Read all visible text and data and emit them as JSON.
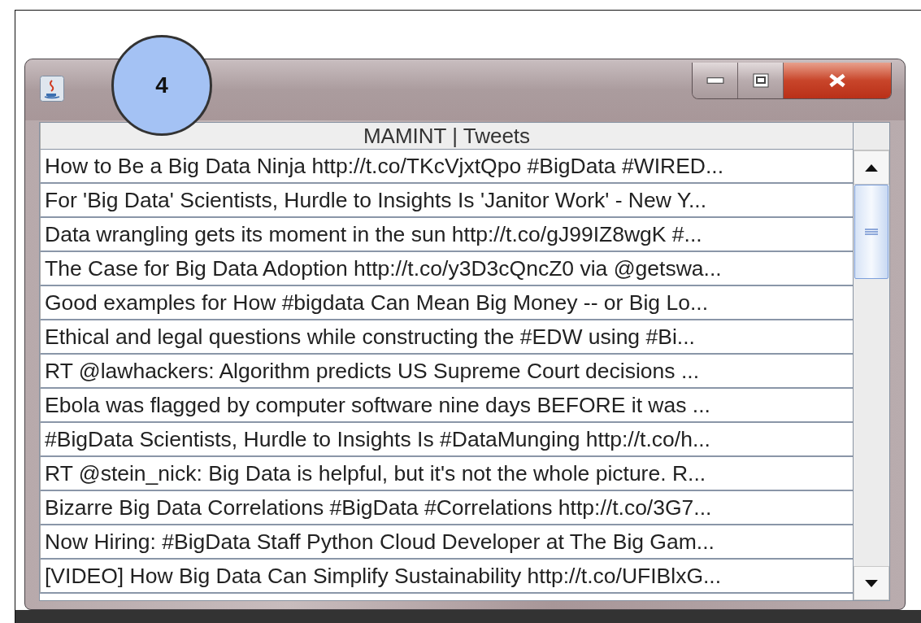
{
  "callout": {
    "label": "4"
  },
  "table": {
    "columns": [
      "MAMINT | Tweets"
    ],
    "rows": [
      {
        "text": "How to Be a Big Data Ninja http://t.co/TKcVjxtQpo #BigData #WIRED..."
      },
      {
        "text": "For 'Big Data' Scientists, Hurdle to Insights Is 'Janitor Work' - New Y..."
      },
      {
        "text": "Data wrangling gets its moment in the sun http://t.co/gJ99IZ8wgK #..."
      },
      {
        "text": "The Case for Big Data Adoption http://t.co/y3D3cQncZ0 via @getswa..."
      },
      {
        "text": "Good examples for How #bigdata Can Mean Big Money -- or Big Lo..."
      },
      {
        "text": "Ethical and legal questions while constructing the #EDW using #Bi..."
      },
      {
        "text": "RT @lawhackers: Algorithm predicts US Supreme Court decisions ..."
      },
      {
        "text": "Ebola was flagged by computer software nine days BEFORE it was ..."
      },
      {
        "text": "#BigData Scientists, Hurdle to Insights Is #DataMunging http://t.co/h..."
      },
      {
        "text": "RT @stein_nick: Big Data is helpful, but it's not the whole picture. R..."
      },
      {
        "text": "Bizarre Big Data Correlations #BigData #Correlations http://t.co/3G7..."
      },
      {
        "text": "Now Hiring: #BigData Staff Python Cloud Developer at The Big Gam..."
      },
      {
        "text": "[VIDEO] How Big Data Can Simplify Sustainability http://t.co/UFIBlxG..."
      }
    ]
  }
}
